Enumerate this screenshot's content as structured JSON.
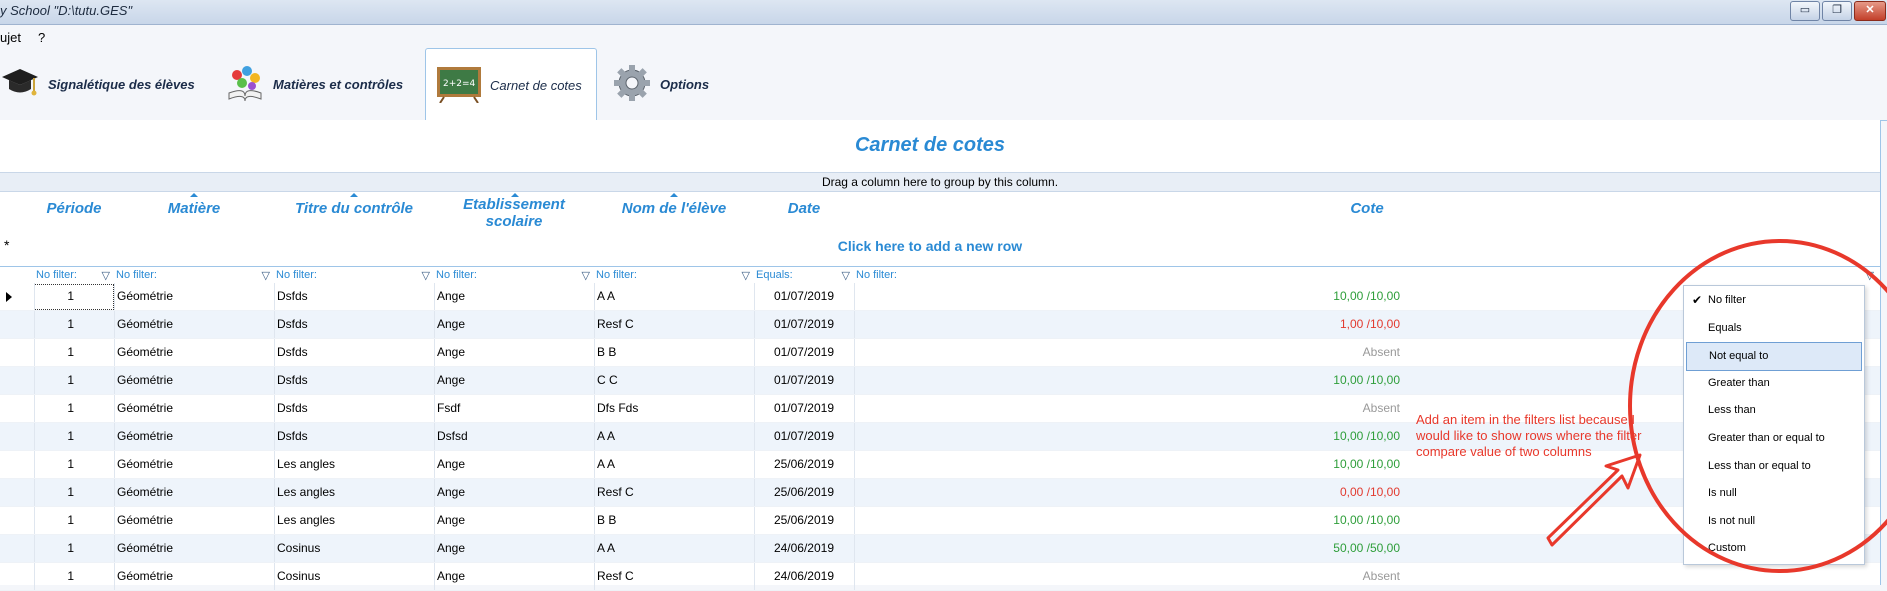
{
  "window": {
    "title": "y School  \"D:\\tutu.GES\"",
    "minimize_label": "▭",
    "restore_label": "❐",
    "close_label": "✕"
  },
  "menu": {
    "items": [
      "ujet",
      "?"
    ]
  },
  "tabs": [
    {
      "label": "Signalétique des élèves",
      "icon": "graduation-cap-icon"
    },
    {
      "label": "Matières et contrôles",
      "icon": "book-icon"
    },
    {
      "label": "Carnet de cotes",
      "icon": "chalkboard-icon",
      "active": true
    },
    {
      "label": "Options",
      "icon": "gear-icon"
    }
  ],
  "panel": {
    "heading": "Carnet de cotes",
    "group_hint": "Drag a column here to group by this column.",
    "new_row_label": "Click here to add a new row",
    "new_row_symbol": "*"
  },
  "columns": [
    {
      "header": "Période",
      "header_line2": "",
      "filter": "No filter:",
      "sorted": false
    },
    {
      "header": "Matière",
      "header_line2": "",
      "filter": "No filter:",
      "sorted": true
    },
    {
      "header": "Titre du contrôle",
      "header_line2": "",
      "filter": "No filter:",
      "sorted": true
    },
    {
      "header": "Etablissement",
      "header_line2": "scolaire",
      "filter": "No filter:",
      "sorted": true
    },
    {
      "header": "Nom de l'élève",
      "header_line2": "",
      "filter": "No filter:",
      "sorted": true
    },
    {
      "header": "Date",
      "header_line2": "",
      "filter": "Equals:",
      "sorted": false
    },
    {
      "header": "Cote",
      "header_line2": "",
      "filter": "No filter:",
      "sorted": false
    }
  ],
  "rows": [
    {
      "periode": "1",
      "matiere": "Géométrie",
      "titre": "Dsfds",
      "etab": "Ange",
      "nom": "A A",
      "date": "01/07/2019",
      "cote": "10,00 /10,00",
      "cote_color": "#2e9e3a"
    },
    {
      "periode": "1",
      "matiere": "Géométrie",
      "titre": "Dsfds",
      "etab": "Ange",
      "nom": "Resf C",
      "date": "01/07/2019",
      "cote": "1,00 /10,00",
      "cote_color": "#e23a2f"
    },
    {
      "periode": "1",
      "matiere": "Géométrie",
      "titre": "Dsfds",
      "etab": "Ange",
      "nom": "B B",
      "date": "01/07/2019",
      "cote": "Absent",
      "cote_color": "#999999"
    },
    {
      "periode": "1",
      "matiere": "Géométrie",
      "titre": "Dsfds",
      "etab": "Ange",
      "nom": "C C",
      "date": "01/07/2019",
      "cote": "10,00 /10,00",
      "cote_color": "#2e9e3a"
    },
    {
      "periode": "1",
      "matiere": "Géométrie",
      "titre": "Dsfds",
      "etab": "Fsdf",
      "nom": "Dfs Fds",
      "date": "01/07/2019",
      "cote": "Absent",
      "cote_color": "#999999"
    },
    {
      "periode": "1",
      "matiere": "Géométrie",
      "titre": "Dsfds",
      "etab": "Dsfsd",
      "nom": "A A",
      "date": "01/07/2019",
      "cote": "10,00 /10,00",
      "cote_color": "#2e9e3a"
    },
    {
      "periode": "1",
      "matiere": "Géométrie",
      "titre": "Les angles",
      "etab": "Ange",
      "nom": "A A",
      "date": "25/06/2019",
      "cote": "10,00 /10,00",
      "cote_color": "#2e9e3a"
    },
    {
      "periode": "1",
      "matiere": "Géométrie",
      "titre": "Les angles",
      "etab": "Ange",
      "nom": "Resf C",
      "date": "25/06/2019",
      "cote": "0,00 /10,00",
      "cote_color": "#e23a2f"
    },
    {
      "periode": "1",
      "matiere": "Géométrie",
      "titre": "Les angles",
      "etab": "Ange",
      "nom": "B B",
      "date": "25/06/2019",
      "cote": "10,00 /10,00",
      "cote_color": "#2e9e3a"
    },
    {
      "periode": "1",
      "matiere": "Géométrie",
      "titre": "Cosinus",
      "etab": "Ange",
      "nom": "A A",
      "date": "24/06/2019",
      "cote": "50,00 /50,00",
      "cote_color": "#2e9e3a"
    },
    {
      "periode": "1",
      "matiere": "Géométrie",
      "titre": "Cosinus",
      "etab": "Ange",
      "nom": "Resf C",
      "date": "24/06/2019",
      "cote": "Absent",
      "cote_color": "#999999"
    }
  ],
  "annotation": {
    "note": "Add an item in the filters list because I would like to show rows where the filter compare value of two columns",
    "color": "#e8382b"
  },
  "filter_menu": {
    "checked_item": "No filter",
    "highlighted_item": "Not equal to",
    "items": [
      "No filter",
      "Equals",
      "Not equal to",
      "Greater than",
      "Less than",
      "Greater than or equal to",
      "Less than or equal to",
      "Is null",
      "Is not null",
      "Custom"
    ]
  },
  "colors": {
    "accent": "#2a8ad4",
    "pass": "#2e9e3a",
    "fail": "#e23a2f",
    "absent": "#999999"
  }
}
